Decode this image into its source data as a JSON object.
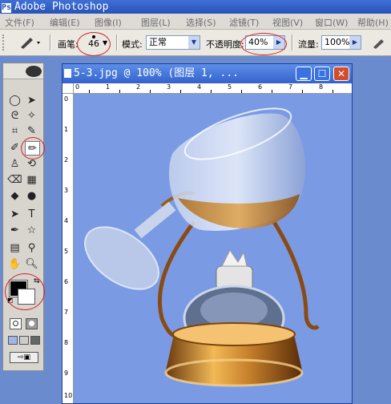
{
  "app": {
    "title": "Adobe Photoshop",
    "logo_glyph": "Ps"
  },
  "menu": [
    "文件(F)",
    "编辑(E)",
    "图像(I)",
    "图层(L)",
    "选择(S)",
    "滤镜(T)",
    "视图(V)",
    "窗口(W)",
    "帮助(H)"
  ],
  "options": {
    "brush_label": "画笔:",
    "brush_size": "46",
    "mode_label": "模式:",
    "mode_value": "正常",
    "opacity_label": "不透明度:",
    "opacity_value": "40%",
    "flow_label": "流量:",
    "flow_value": "100%"
  },
  "document": {
    "title": "5-3.jpg @ 100% (图层 1, ...",
    "ruler_top": [
      "0",
      "1",
      "2",
      "3",
      "4",
      "5",
      "6",
      "7",
      "8"
    ],
    "ruler_left": [
      "0",
      "1",
      "2",
      "3",
      "4",
      "5",
      "6",
      "7",
      "8",
      "9",
      "10"
    ],
    "canvas_bg": "#7a9be3"
  },
  "colors": {
    "accent": "#d4202a",
    "foreground": "#000000",
    "background": "#ffffff"
  }
}
